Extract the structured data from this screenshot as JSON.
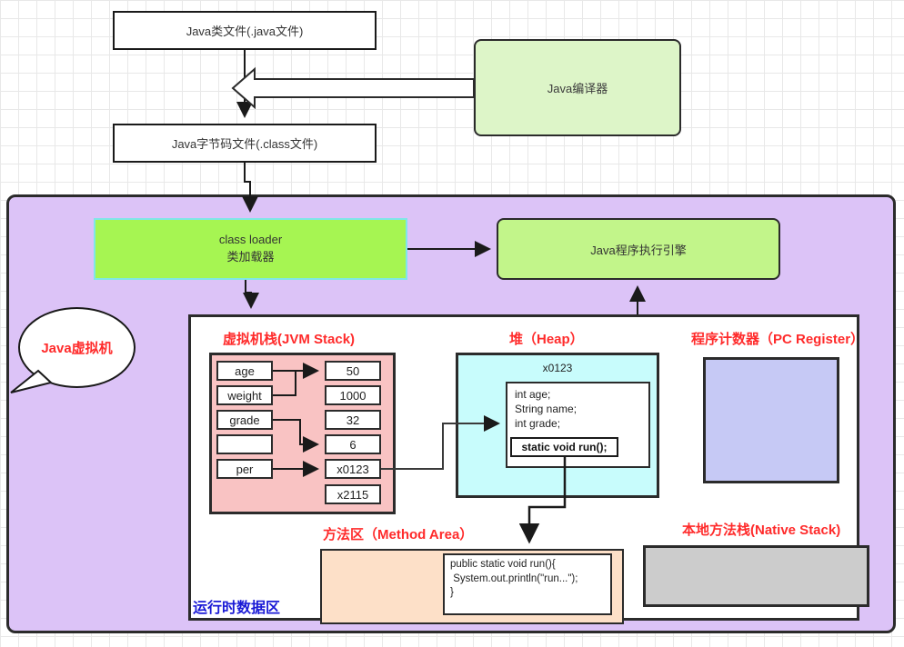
{
  "diagram": {
    "title": "Java Virtual Machine Runtime Data Area",
    "colors": {
      "compiler_fill": "#ddf5c8",
      "classloader_fill": "#a6f552",
      "engine_fill": "#c2f58a",
      "jvm_fill": "#dcc3f7",
      "stack_fill": "#f9c3c3",
      "heap_fill": "#c8fcfc",
      "pc_fill": "#c6c9f5",
      "method_fill": "#fde0c8",
      "native_fill": "#cccccc",
      "section_title": "#ff2b2b",
      "runtime_label": "#1a1ad6"
    }
  },
  "top_flow": {
    "java_source": "Java类文件(.java文件)",
    "java_bytecode": "Java字节码文件(.class文件)",
    "compiler": "Java编译器"
  },
  "jvm": {
    "bubble_label": "Java虚拟机",
    "class_loader_line1": "class loader",
    "class_loader_line2": "类加载器",
    "exec_engine": "Java程序执行引擎",
    "runtime_area_label": "运行时数据区"
  },
  "jvm_stack": {
    "title": "虚拟机栈(JVM Stack)",
    "variables": [
      "age",
      "weight",
      "grade",
      "",
      "per"
    ],
    "slots": [
      "50",
      "1000",
      "32",
      "6",
      "x0123",
      "x2115"
    ]
  },
  "heap": {
    "title": "堆（Heap）",
    "address": "x0123",
    "fields": [
      "int age;",
      "String name;",
      "int grade;"
    ],
    "method": "static void run();"
  },
  "pc_register": {
    "title": "程序计数器（PC Register）"
  },
  "method_area": {
    "title": "方法区（Method Area）",
    "code": "public static void run(){\n System.out.println(\"run...\");\n}"
  },
  "native_stack": {
    "title": "本地方法栈(Native Stack)"
  }
}
